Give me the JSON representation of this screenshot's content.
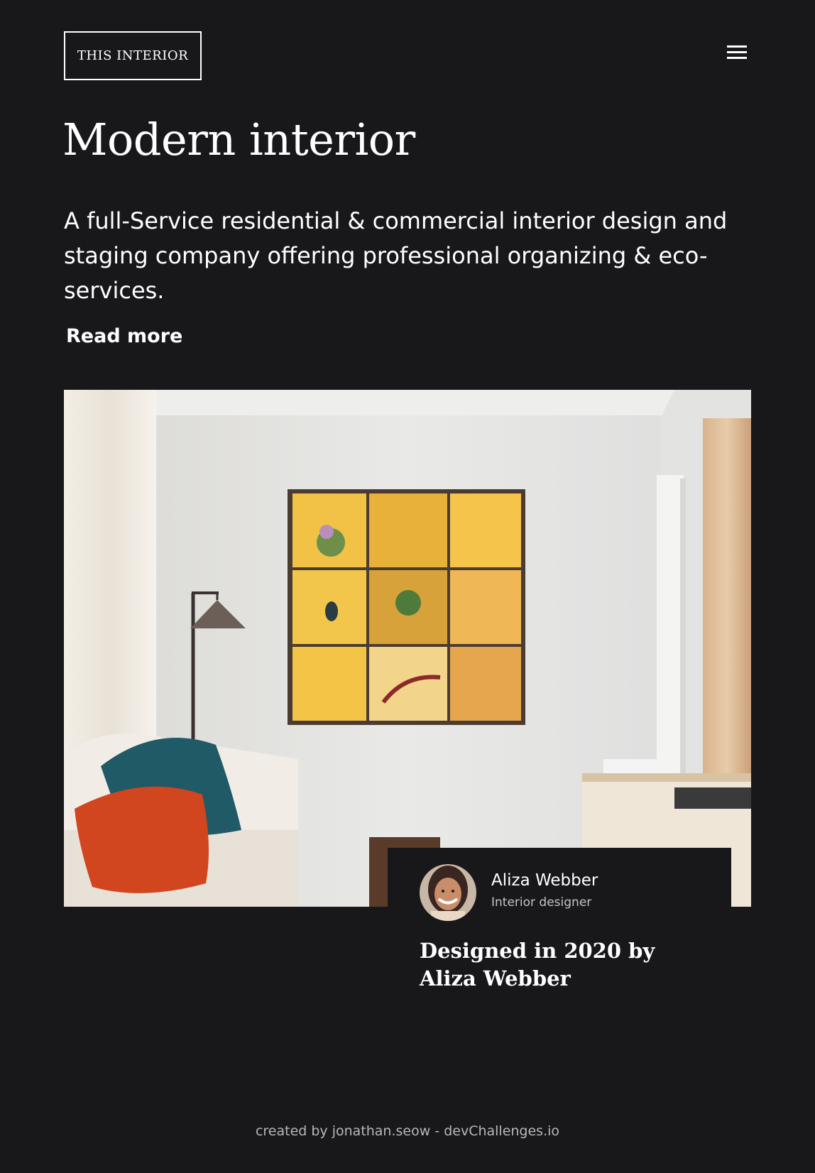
{
  "header": {
    "logo_text": "THIS INTERIOR",
    "menu_icon": "hamburger-menu-icon"
  },
  "hero": {
    "title": "Modern interior",
    "description": "A full-Service residential & commercial interior design and staging company offering professional organizing & eco-services.",
    "read_more_label": "Read more"
  },
  "designer": {
    "name": "Aliza Webber",
    "role": "Interior designer",
    "caption": "Designed in 2020 by Aliza Webber"
  },
  "footer": {
    "credit": "created by jonathan.seow - devChallenges.io"
  },
  "colors": {
    "background": "#18181b",
    "text": "#ffffff",
    "muted_text": "#b8b8bc"
  }
}
